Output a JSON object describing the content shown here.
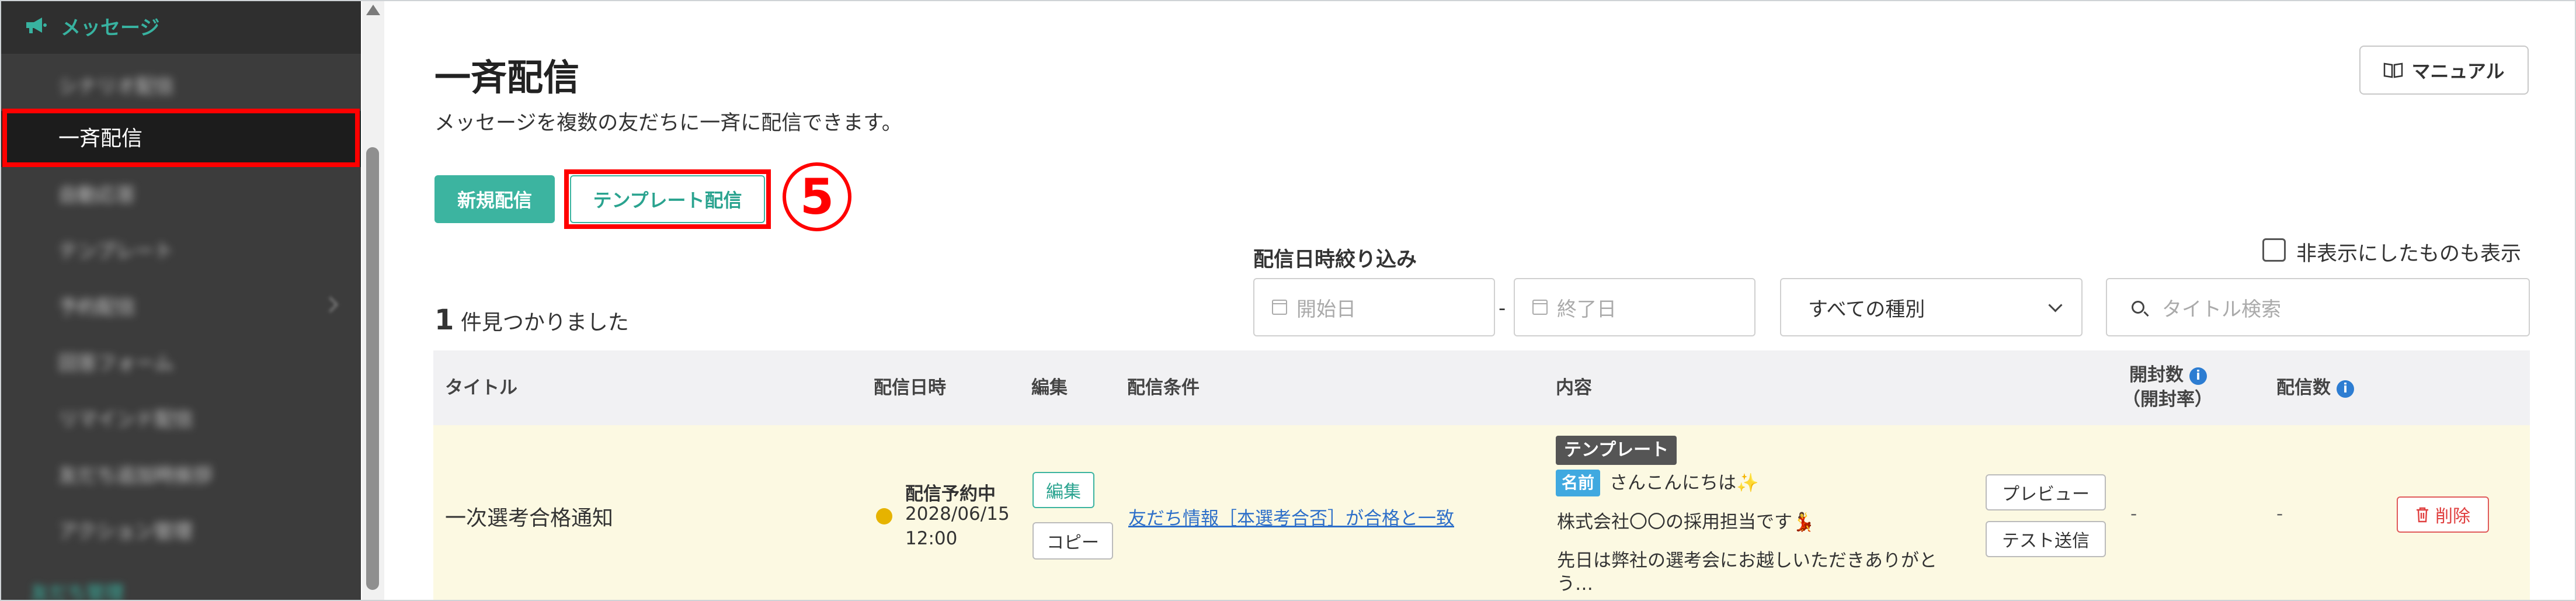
{
  "sidebar": {
    "header_label": "メッセージ",
    "items": [
      {
        "label": "シナリオ配信"
      },
      {
        "label": "一斉配信"
      },
      {
        "label": "自動応答"
      },
      {
        "label": "テンプレート"
      },
      {
        "label": "予約配信"
      },
      {
        "label": "回答フォーム"
      },
      {
        "label": "リマインド配信"
      },
      {
        "label": "友だち追加時挨拶"
      },
      {
        "label": "アクション管理"
      },
      {
        "label": "友だち管理"
      }
    ]
  },
  "header": {
    "title": "一斉配信",
    "subtitle": "メッセージを複数の友だちに一斉に配信できます。",
    "manual_label": "マニュアル"
  },
  "toolbar": {
    "new_label": "新規配信",
    "template_label": "テンプレート配信",
    "step_number": "5"
  },
  "filters": {
    "date_label": "配信日時絞り込み",
    "start_placeholder": "開始日",
    "date_separator": "-",
    "end_placeholder": "終了日",
    "type_value": "すべての種別",
    "search_placeholder": "タイトル検索",
    "show_hidden_label": "非表示にしたものも表示"
  },
  "results": {
    "count": "1",
    "suffix": "件見つかりました"
  },
  "table": {
    "headers": {
      "title": "タイトル",
      "date": "配信日時",
      "edit": "編集",
      "condition": "配信条件",
      "content": "内容",
      "open_count": "開封数",
      "open_rate": "（開封率）",
      "sent_count": "配信数"
    },
    "rows": [
      {
        "title": "一次選考合格通知",
        "status": "配信予約中",
        "date": "2028/06/15",
        "time": "12:00",
        "status_color": "#e6b300",
        "edit_label": "編集",
        "copy_label": "コピー",
        "condition": "友だち情報［本選考合否］が合格と一致",
        "template_badge": "テンプレート",
        "name_tag": "名前",
        "content_line1": "さんこんにちは✨",
        "content_line2": "株式会社〇〇の採用担当です💃",
        "content_line3": "先日は弊社の選考会にお越しいただきありがと",
        "content_line4": "う…",
        "preview_label": "プレビュー",
        "test_label": "テスト送信",
        "open_value": "-",
        "sent_value": "-",
        "delete_label": "削除"
      }
    ]
  },
  "colors": {
    "accent": "#3cb4a0",
    "highlight": "#ff0000",
    "sidebar_bg": "#3c3c3c",
    "row_bg": "#fcf9e2",
    "link": "#2d6fc9",
    "danger": "#e04040"
  },
  "icons": {
    "sidebar_header": "megaphone-icon",
    "manual": "book-icon",
    "calendar": "calendar-icon",
    "search": "search-icon",
    "info": "info-icon",
    "delete": "trash-icon"
  }
}
